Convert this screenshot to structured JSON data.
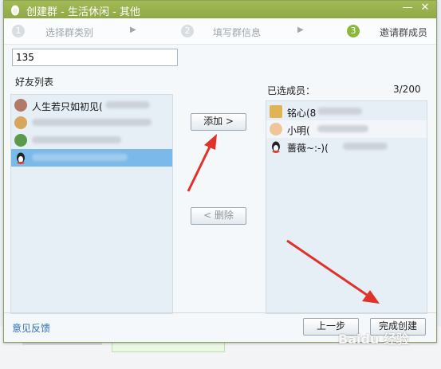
{
  "window": {
    "title": "创建群 - 生活休闲 - 其他",
    "minimize": "—",
    "close": "✕"
  },
  "steps": [
    {
      "num": "1",
      "label": "选择群类别",
      "active": false
    },
    {
      "num": "2",
      "label": "填写群信息",
      "active": false
    },
    {
      "num": "3",
      "label": "邀请群成员",
      "active": true
    }
  ],
  "step_arrow": "▶",
  "search": {
    "value": "135"
  },
  "friends": {
    "heading": "好友列表",
    "items": [
      {
        "name": "人生若只如初见(",
        "avatar_color": "#b07a66",
        "selected": false
      },
      {
        "name": "…",
        "avatar_color": "#d7a55b",
        "selected": false
      },
      {
        "name": "",
        "avatar_color": "#5a9a4a",
        "selected": false
      },
      {
        "name": "",
        "avatar_color": "#333333",
        "selected": true
      }
    ]
  },
  "buttons": {
    "add": "添加 >",
    "remove": "< 删除",
    "back": "上一步",
    "finish": "完成创建"
  },
  "members": {
    "heading": "已选成员：",
    "count": "3/200",
    "items": [
      {
        "name": "铭心(8",
        "avatar_color": "#e0b455"
      },
      {
        "name": "小明(",
        "avatar_color": "#f0c59a"
      },
      {
        "name": "蔷薇~:-)(",
        "avatar_color": "#222222"
      }
    ]
  },
  "footer": {
    "feedback": "意见反馈",
    "watermark": "Baidu 经验"
  },
  "colors": {
    "titlebar": "#97af4f",
    "selected_row": "#7ab9e9",
    "annotation_arrow": "#e0312b"
  }
}
